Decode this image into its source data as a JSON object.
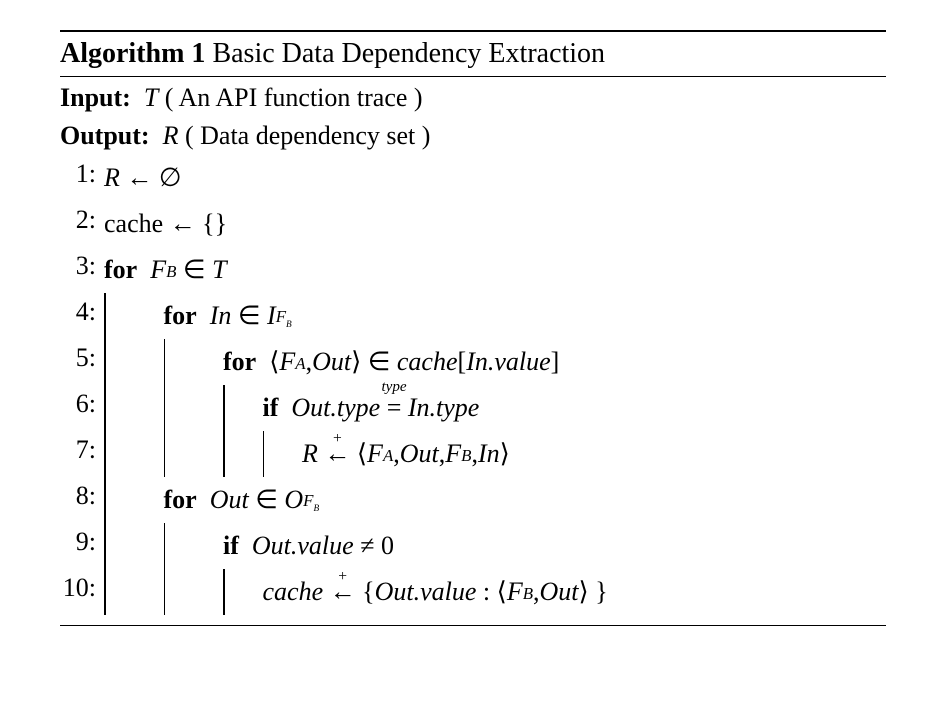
{
  "algo_label": "Algorithm 1",
  "algo_title": "Basic Data Dependency Extraction",
  "input_label": "Input:",
  "input_text_a": "T",
  "input_text_b": "( An API function trace )",
  "output_label": "Output:",
  "output_text_a": "R",
  "output_text_b": "( Data dependency set )",
  "lines": {
    "l1": "1:",
    "l2": "2:",
    "l3": "3:",
    "l4": "4:",
    "l5": "5:",
    "l6": "6:",
    "l7": "7:",
    "l8": "8:",
    "l9": "9:",
    "l10": "10:"
  },
  "kw": {
    "for": "for",
    "if": "if"
  },
  "sym": {
    "R": "R",
    "emptyset": "∅",
    "cache": "cache",
    "larr": "←",
    "braces": "{}",
    "FB": "F",
    "B": "B",
    "A": "A",
    "in": "∈",
    "T": "T",
    "In": "In",
    "I": "I",
    "langle": "⟨",
    "rangle": "⟩",
    "FA": "F",
    "Out": "Out",
    "lbr": "[",
    "rbr": "]",
    "value": ".value",
    "type": ".type",
    "eq": "=",
    "typetop": "type",
    "plus": "+",
    "comma": ",",
    "O": "O",
    "neq": "≠",
    "zero": "0",
    "colon": ":",
    "lbrace": "{",
    "rbrace": "}"
  }
}
